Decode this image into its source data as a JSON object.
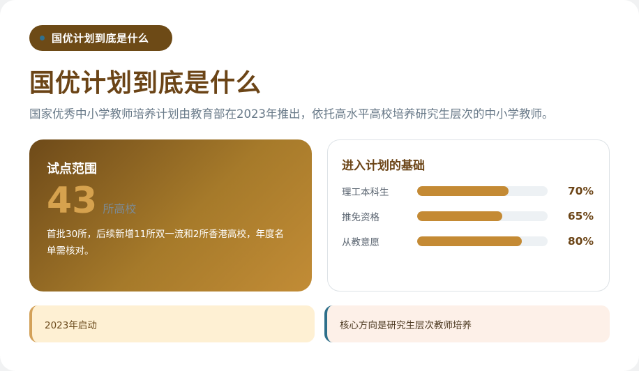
{
  "badge": {
    "label": "国优计划到底是什么"
  },
  "header": {
    "title": "国优计划到底是什么",
    "subtitle": "国家优秀中小学教师培养计划由教育部在2023年推出，依托高水平高校培养研究生层次的中小学教师。"
  },
  "pilot_card": {
    "heading": "试点范围",
    "number": "43",
    "unit": "所高校",
    "note": "首批30所，后续新增11所双一流和2所香港高校，年度名单需核对。"
  },
  "basis_card": {
    "heading": "进入计划的基础",
    "rows": [
      {
        "label": "理工本科生",
        "value": "70%",
        "percent": 70
      },
      {
        "label": "推免资格",
        "value": "65%",
        "percent": 65
      },
      {
        "label": "从教意愿",
        "value": "80%",
        "percent": 80
      }
    ]
  },
  "notes": {
    "left": "2023年启动",
    "right": "核心方向是研究生层次教师培养"
  },
  "colors": {
    "brand_brown": "#6b4416",
    "accent_gold": "#c48a34",
    "accent_teal": "#2e6f8a"
  }
}
